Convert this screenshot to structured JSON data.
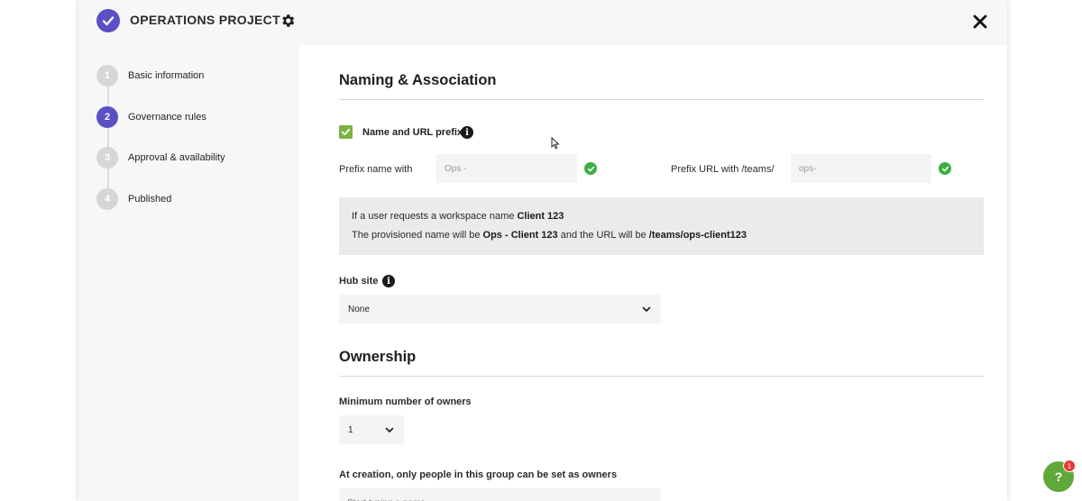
{
  "header": {
    "project_title": "OPERATIONS PROJECT",
    "accent_color": "#5a4fc4"
  },
  "steps": [
    {
      "number": "1",
      "label": "Basic information",
      "active": false
    },
    {
      "number": "2",
      "label": "Governance rules",
      "active": true
    },
    {
      "number": "3",
      "label": "Approval & availability",
      "active": false
    },
    {
      "number": "4",
      "label": "Published",
      "active": false
    }
  ],
  "naming": {
    "section_title": "Naming & Association",
    "checkbox_label": "Name and URL prefix",
    "checkbox_checked": true,
    "prefix_name_label": "Prefix name with",
    "prefix_name_value": "Ops -",
    "prefix_url_label": "Prefix URL with /teams/",
    "prefix_url_value": "ops-",
    "preview_line1_text": "If a user requests a workspace name",
    "preview_line1_bold": "Client 123",
    "preview_line2_a": "The provisioned name will be",
    "preview_line2_b": "Ops - Client 123",
    "preview_line2_c": "and the URL will be",
    "preview_line2_d": "/teams/ops-client123",
    "hub_label": "Hub site",
    "hub_value": "None"
  },
  "ownership": {
    "section_title": "Ownership",
    "min_owners_label": "Minimum number of owners",
    "min_owners_value": "1",
    "group_label": "At creation, only people in this group can be set as owners",
    "group_placeholder": "Start typing a name"
  },
  "help": {
    "label": "?",
    "badge_count": "1",
    "color": "#5fa83a"
  }
}
